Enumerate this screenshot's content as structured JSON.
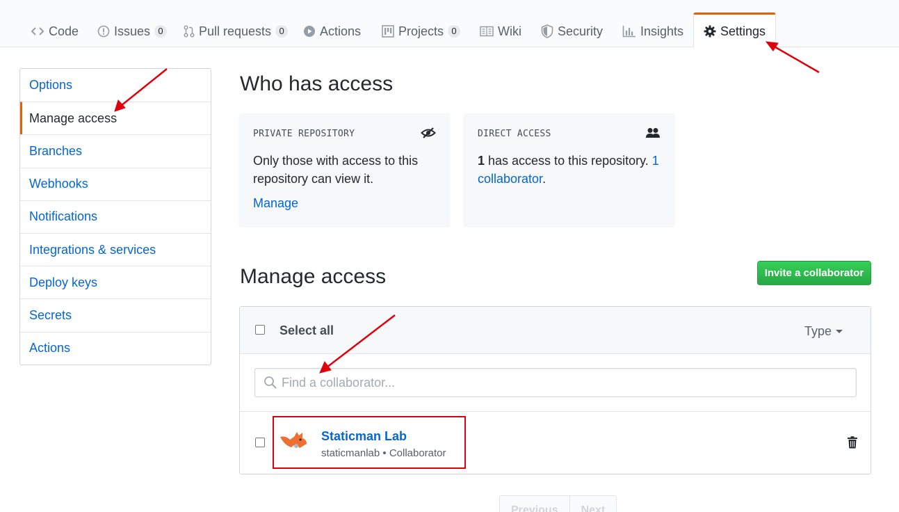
{
  "tabs": {
    "code": {
      "label": "Code"
    },
    "issues": {
      "label": "Issues",
      "count": "0"
    },
    "pulls": {
      "label": "Pull requests",
      "count": "0"
    },
    "actions": {
      "label": "Actions"
    },
    "projects": {
      "label": "Projects",
      "count": "0"
    },
    "wiki": {
      "label": "Wiki"
    },
    "security": {
      "label": "Security"
    },
    "insights": {
      "label": "Insights"
    },
    "settings": {
      "label": "Settings",
      "selected": true
    }
  },
  "sidebar": {
    "items": [
      {
        "label": "Options"
      },
      {
        "label": "Manage access",
        "selected": true
      },
      {
        "label": "Branches"
      },
      {
        "label": "Webhooks"
      },
      {
        "label": "Notifications"
      },
      {
        "label": "Integrations & services"
      },
      {
        "label": "Deploy keys"
      },
      {
        "label": "Secrets"
      },
      {
        "label": "Actions"
      }
    ]
  },
  "who": {
    "title": "Who has access",
    "private": {
      "heading": "PRIVATE REPOSITORY",
      "text": "Only those with access to this repository can view it.",
      "link": "Manage",
      "icon": "eye-closed-icon"
    },
    "direct": {
      "heading": "DIRECT ACCESS",
      "count": "1",
      "text": " has access to this repository. ",
      "link": "1 collaborator",
      "after": ".",
      "icon": "people-icon"
    }
  },
  "manage": {
    "title": "Manage access",
    "invite_label": "Invite a collaborator",
    "select_all": "Select all",
    "type_filter": "Type",
    "search_placeholder": "Find a collaborator...",
    "members": [
      {
        "name": "Staticman Lab",
        "username": "staticmanlab",
        "role": "Collaborator"
      }
    ]
  },
  "pagination": {
    "previous": "Previous",
    "next": "Next"
  },
  "colors": {
    "accent_orange": "#e36209",
    "link_blue": "#0366d6",
    "button_green": "#28a745",
    "annotation_red": "#e0000c"
  }
}
